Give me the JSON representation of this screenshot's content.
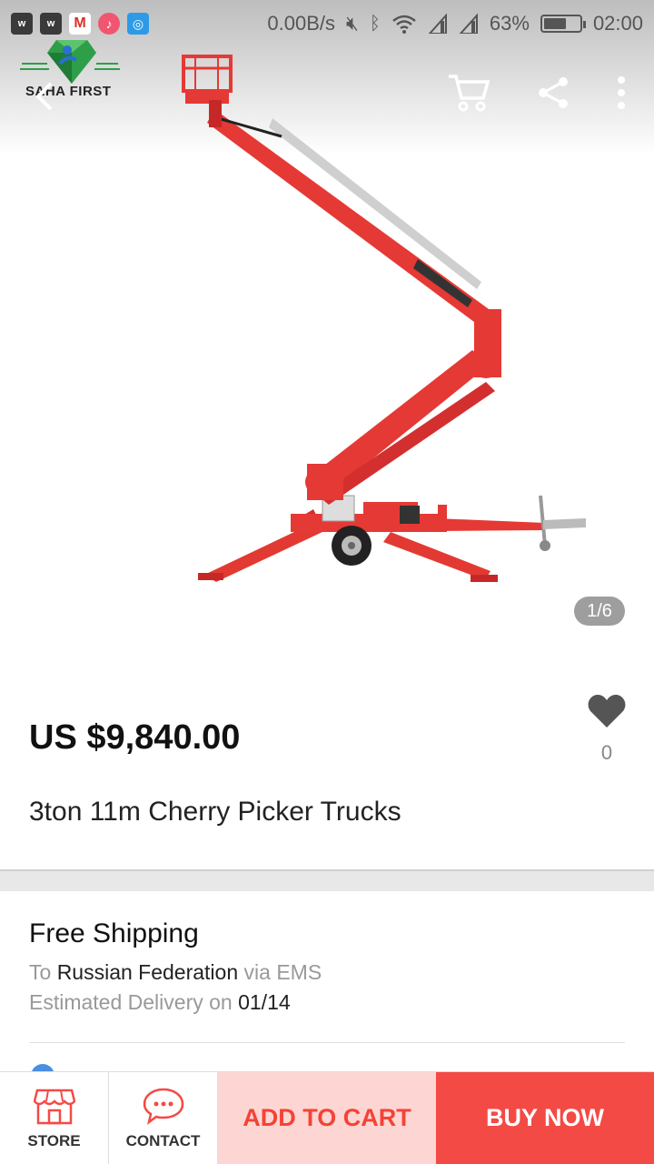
{
  "status_bar": {
    "net_speed": "0.00B/s",
    "battery": "63%",
    "battery_level": 0.63,
    "time": "02:00"
  },
  "header": {
    "logo_text": "SAHA FIRST",
    "icons": [
      "back-arrow-icon",
      "cart-icon",
      "share-icon",
      "more-vert-icon"
    ]
  },
  "gallery": {
    "counter": "1/6",
    "image_subject": "red trailer-mounted articulated boom lift"
  },
  "product": {
    "price": "US $9,840.00",
    "wishlist_count": "0",
    "title": "3ton 11m Cherry Picker Trucks"
  },
  "shipping": {
    "title": "Free Shipping",
    "to_prefix": "To",
    "destination": "Russian Federation",
    "via": "via EMS",
    "delivery_prefix": "Estimated Delivery on",
    "delivery_date": "01/14"
  },
  "bottom_bar": {
    "store": "STORE",
    "contact": "CONTACT",
    "add_to_cart": "ADD TO CART",
    "buy_now": "BUY NOW"
  },
  "colors": {
    "accent": "#f44a45",
    "cart_bg": "#fdd6d4",
    "cart_text": "#f44336",
    "boom_red": "#e53935"
  }
}
